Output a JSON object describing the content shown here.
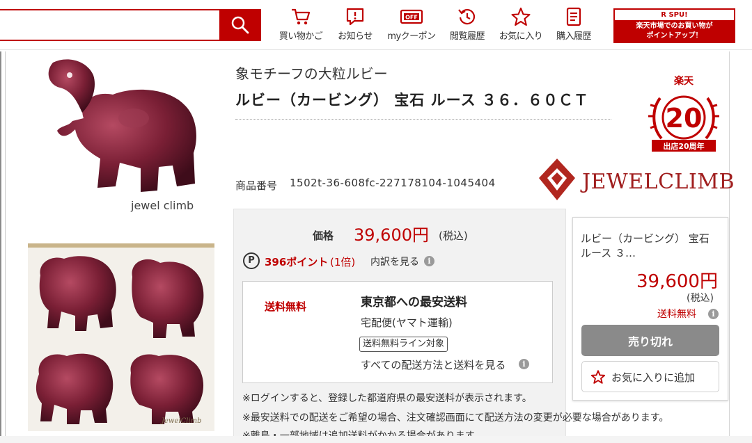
{
  "search": {
    "value": "",
    "placeholder": ""
  },
  "nav": [
    {
      "label": "買い物かご",
      "icon": "cart-icon"
    },
    {
      "label": "お知らせ",
      "icon": "notification-icon"
    },
    {
      "label": "myクーポン",
      "icon": "coupon-icon",
      "badge": "OFF"
    },
    {
      "label": "閲覧履歴",
      "icon": "history-icon"
    },
    {
      "label": "お気に入り",
      "icon": "star-icon"
    },
    {
      "label": "購入履歴",
      "icon": "purchase-history-icon"
    }
  ],
  "spu_banner": {
    "title": "R SPU!",
    "line1": "楽天市場でのお買い物が",
    "line2": "ポイントアップ！"
  },
  "images": {
    "main_caption": "jewel climb",
    "thumb_caption": "JewelClimb"
  },
  "product": {
    "catch_copy": "象モチーフの大粒ルビー",
    "name": "ルビー（カービング） 宝石 ルース ３６．６０ＣＴ",
    "item_number_label": "商品番号",
    "item_number": "1502t-36-608fc-227178104-1045404"
  },
  "badge": {
    "brand": "楽天",
    "number": "20",
    "caption": "出店20周年"
  },
  "shop": {
    "logo_text": "JEWELCLIMB"
  },
  "price": {
    "label": "価格",
    "value": "39,600円",
    "tax": "(税込)",
    "points": "396ポイント",
    "point_rate": "(1倍)",
    "point_detail": "内訳を見る",
    "point_icon": "P"
  },
  "shipping": {
    "free_label": "送料無料",
    "heading": "東京都への最安送料",
    "carrier": "宅配便(ヤマト運輸)",
    "tag": "送料無料ライン対象",
    "link": "すべての配送方法と送料を見る"
  },
  "notes": [
    "※ログインすると、登録した都道府県の最安送料が表示されます。",
    "※最安送料での配送をご希望の場合、注文確認画面にて配送方法の変更が必要な場合があります。",
    "※離島・一部地域は追加送料がかかる場合があります。"
  ],
  "buybox": {
    "name": "ルビー（カービング） 宝石 ルース ３…",
    "price": "39,600円",
    "tax": "(税込)",
    "shipping": "送料無料",
    "soldout": "売り切れ",
    "favorite": "お気に入りに追加"
  },
  "colors": {
    "accent": "#bf0000",
    "soldout": "#8a8a8a",
    "ruby": "#7a1f35"
  }
}
